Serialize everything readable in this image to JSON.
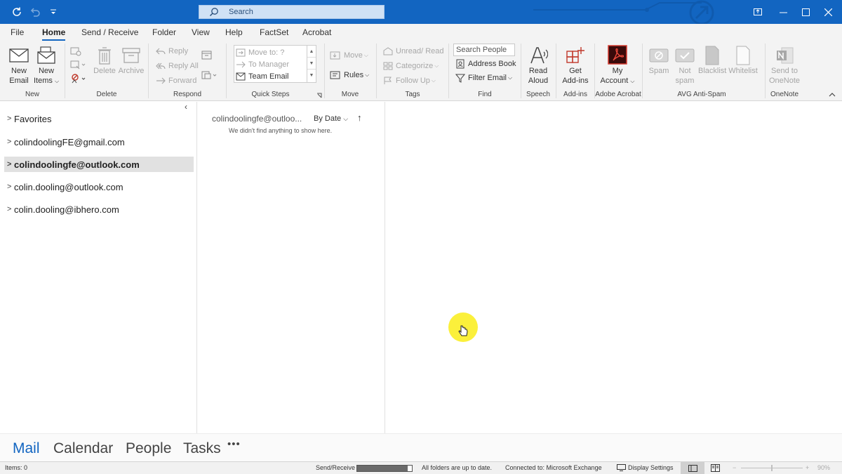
{
  "titlebar": {
    "search_label": "Search"
  },
  "menu": {
    "tabs": [
      {
        "label": "File"
      },
      {
        "label": "Home"
      },
      {
        "label": "Send / Receive"
      },
      {
        "label": "Folder"
      },
      {
        "label": "View"
      },
      {
        "label": "Help"
      },
      {
        "label": "FactSet"
      },
      {
        "label": "Acrobat"
      }
    ],
    "active": "Home"
  },
  "ribbon": {
    "new": {
      "new_email_1": "New",
      "new_email_2": "Email",
      "new_items_1": "New",
      "new_items_2": "Items",
      "group": "New"
    },
    "delete": {
      "delete": "Delete",
      "archive": "Archive",
      "group": "Delete"
    },
    "respond": {
      "reply": "Reply",
      "reply_all": "Reply All",
      "forward": "Forward",
      "group": "Respond"
    },
    "quicksteps": {
      "move_to": "Move to: ?",
      "to_manager": "To Manager",
      "team_email": "Team Email",
      "group": "Quick Steps"
    },
    "move": {
      "move": "Move",
      "rules": "Rules",
      "group": "Move"
    },
    "tags": {
      "unread_read": "Unread/ Read",
      "categorize": "Categorize",
      "follow_up": "Follow Up",
      "group": "Tags"
    },
    "find": {
      "search_people": "Search People",
      "address_book": "Address Book",
      "filter_email": "Filter Email",
      "group": "Find"
    },
    "speech": {
      "read_1": "Read",
      "read_2": "Aloud",
      "group": "Speech"
    },
    "addins": {
      "get_1": "Get",
      "get_2": "Add-ins",
      "group": "Add-ins"
    },
    "acrobat": {
      "my_1": "My",
      "my_2": "Account",
      "group": "Adobe Acrobat"
    },
    "avg": {
      "spam": "Spam",
      "not_1": "Not",
      "not_2": "spam",
      "blacklist": "Blacklist",
      "whitelist": "Whitelist",
      "group": "AVG Anti-Spam"
    },
    "onenote": {
      "send_1": "Send to",
      "send_2": "OneNote",
      "group": "OneNote"
    }
  },
  "folders": {
    "items": [
      {
        "label": "Favorites"
      },
      {
        "label": "colindoolingFE@gmail.com"
      },
      {
        "label": "colindoolingfe@outlook.com"
      },
      {
        "label": "colin.dooling@outlook.com"
      },
      {
        "label": "colin.dooling@ibhero.com"
      }
    ],
    "selected": "colindoolingfe@outlook.com"
  },
  "messages": {
    "header": "colindoolingfe@outloo...",
    "sort_label": "By Date",
    "empty_text": "We didn't find anything to show here."
  },
  "nav": {
    "mail": "Mail",
    "calendar": "Calendar",
    "people": "People",
    "tasks": "Tasks",
    "more": "•••"
  },
  "status": {
    "items": "Items: 0",
    "send_receive": "Send/Receive",
    "progress_fraction": 0.92,
    "folders_status": "All folders are up to date.",
    "connected": "Connected to: Microsoft Exchange",
    "display_settings": "Display Settings",
    "zoom": "90%"
  },
  "colors": {
    "accent": "#1265c1",
    "cursor_highlight": "#fbf03b"
  }
}
